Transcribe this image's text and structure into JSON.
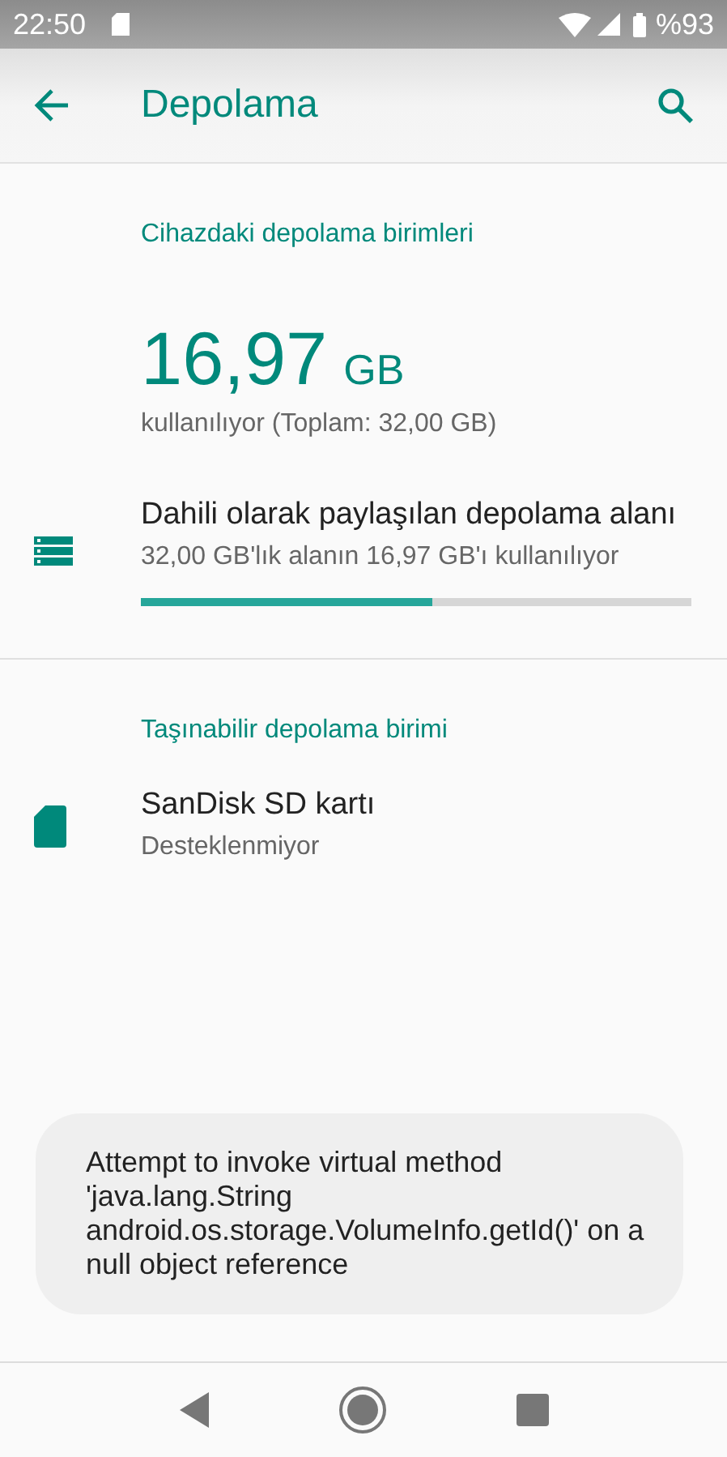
{
  "status_bar": {
    "time": "22:50",
    "battery": "%93"
  },
  "app_bar": {
    "title": "Depolama"
  },
  "sections": [
    {
      "header": "Cihazdaki depolama birimleri",
      "summary": {
        "amount": "16,97",
        "unit": "GB",
        "caption": "kullanılıyor (Toplam: 32,00 GB)"
      },
      "items": [
        {
          "kind": "internal",
          "title": "Dahili olarak paylaşılan depolama alanı",
          "subtitle": "32,00 GB'lık alanın 16,97 GB'ı kullanılıyor",
          "level": 0.53
        }
      ]
    },
    {
      "header": "Taşınabilir depolama birimi",
      "items": [
        {
          "kind": "sdcard",
          "title": "SanDisk SD kartı",
          "subtitle": "Desteklenmiyor"
        }
      ]
    }
  ],
  "toast": "Attempt to invoke virtual method 'java.lang.String android.os.storage.VolumeInfo.getId()' on a null object reference"
}
